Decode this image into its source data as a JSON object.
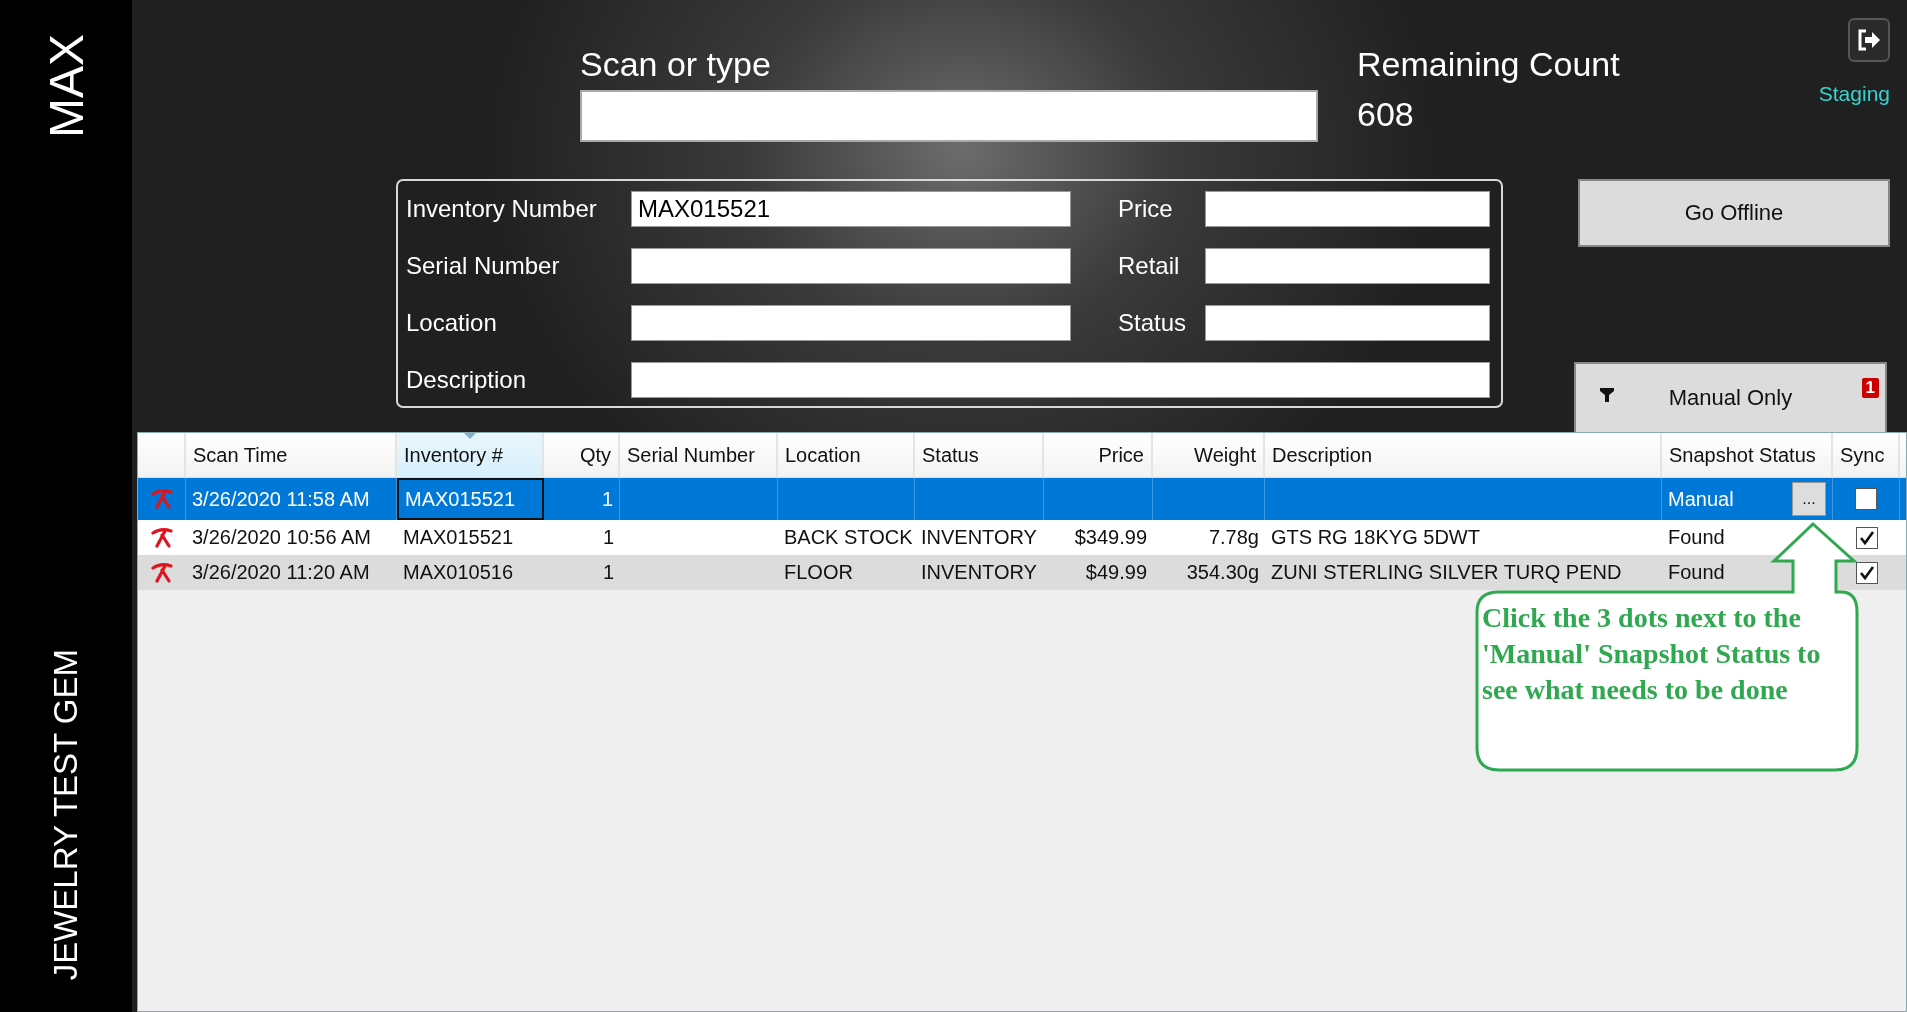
{
  "sidebar": {
    "title": "MAX",
    "subtitle": "JEWELRY TEST GEM"
  },
  "scan": {
    "label": "Scan or type"
  },
  "remaining": {
    "label": "Remaining Count",
    "value": "608"
  },
  "environment": "Staging",
  "form": {
    "left": [
      {
        "label": "Inventory Number",
        "value": "MAX015521"
      },
      {
        "label": "Serial Number"
      },
      {
        "label": "Location"
      }
    ],
    "right": [
      {
        "label": "Price"
      },
      {
        "label": "Retail"
      },
      {
        "label": "Status"
      }
    ],
    "description": {
      "label": "Description"
    }
  },
  "go_offline": "Go Offline",
  "filter": {
    "label": "Manual Only",
    "badge": "1"
  },
  "table": {
    "columns": [
      {
        "label": "Scan Time",
        "sorted": false
      },
      {
        "label": "Inventory #",
        "sorted": true
      },
      {
        "label": "Qty",
        "sorted": false
      },
      {
        "label": "Serial Number",
        "sorted": false
      },
      {
        "label": "Location",
        "sorted": false
      },
      {
        "label": "Status",
        "sorted": false
      },
      {
        "label": "Price",
        "sorted": false
      },
      {
        "label": "Weight",
        "sorted": false
      },
      {
        "label": "Description",
        "sorted": false
      },
      {
        "label": "Snapshot Status",
        "sorted": false
      },
      {
        "label": "Sync",
        "sorted": false
      }
    ],
    "rows": [
      {
        "selected": true,
        "scan_time": "3/26/2020 11:58 AM",
        "inventory": "MAX015521",
        "qty": "1",
        "snapshot_status": "Manual",
        "details_button": "...",
        "sync": false
      },
      {
        "selected": false,
        "scan_time": "3/26/2020 10:56 AM",
        "inventory": "MAX015521",
        "qty": "1",
        "location": "BACK STOCK",
        "status": "INVENTORY",
        "price": "$349.99",
        "weight": "7.78g",
        "description": "GTS RG 18KYG 5DWT",
        "snapshot_status": "Found",
        "sync": true
      },
      {
        "selected": false,
        "scan_time": "3/26/2020 11:20 AM",
        "inventory": "MAX010516",
        "qty": "1",
        "location": "FLOOR",
        "status": "INVENTORY",
        "price": "$49.99",
        "weight": "354.30g",
        "description": "ZUNI STERLING SILVER TURQ PEND",
        "snapshot_status": "Found",
        "sync": true
      }
    ]
  },
  "callout": {
    "text": "Click the 3 dots next to the 'Manual' Snapshot Status to see what needs to be done"
  }
}
